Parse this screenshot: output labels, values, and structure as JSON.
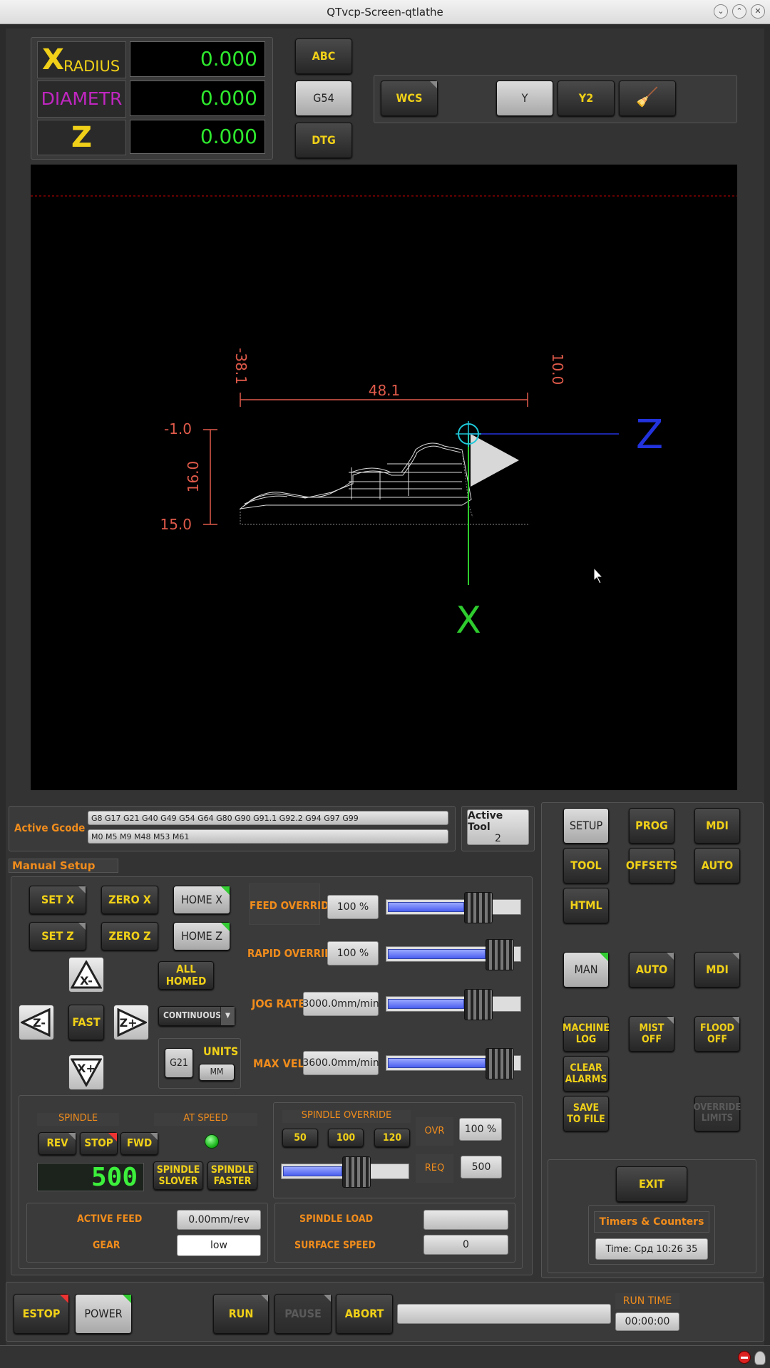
{
  "window": {
    "title": "QTvcp-Screen-qtlathe"
  },
  "dro": {
    "x": {
      "label_big": "X",
      "label_small": "RADIUS",
      "value": "0.000"
    },
    "d": {
      "label": "DIAMETR",
      "value": "0.000"
    },
    "z": {
      "label": "Z",
      "value": "0.000"
    }
  },
  "coord_buttons": {
    "abc": "ABC",
    "g54": "G54",
    "dtg": "DTG"
  },
  "view_buttons": {
    "wcs": "WCS",
    "y": "Y",
    "y2": "Y2"
  },
  "graphics": {
    "dim_z_left": "-38.1",
    "dim_z_right": "10.0",
    "dim_length": "48.1",
    "dim_x_top": "-1.0",
    "dim_x_len": "16.0",
    "dim_x_bottom": "15.0",
    "axis_z": "Z",
    "axis_x": "X"
  },
  "gcode": {
    "label": "Active Gcode",
    "g_codes": "G8 G17 G21 G40 G49 G54 G64 G80 G90 G91.1 G92.2 G94 G97 G99",
    "m_codes": "M0 M5 M9 M48 M53 M61"
  },
  "tool": {
    "label": "Active Tool",
    "value": "2"
  },
  "manual": {
    "title": "Manual Setup",
    "set_x": "SET X",
    "zero_x": "ZERO X",
    "home_x": "HOME X",
    "set_z": "SET Z",
    "zero_z": "ZERO Z",
    "home_z": "HOME Z",
    "all_homed": "ALL HOMED",
    "fast": "FAST",
    "continuous": "CONTINUOUS",
    "g21": "G21",
    "units": "UNITS",
    "mm": "MM",
    "jog_x_minus": "X-",
    "jog_x_plus": "X+",
    "jog_z_minus": "Z-",
    "jog_z_plus": "Z+"
  },
  "overrides": {
    "feed": {
      "label": "FEED OVERRIDE",
      "value": "100 %",
      "level": 0.78
    },
    "rapid": {
      "label": "RAPID OVERRIDE",
      "value": "100 %",
      "level": 1.0
    },
    "jog": {
      "label": "JOG RATE",
      "value": "3000.0mm/min",
      "level": 0.78
    },
    "maxvel": {
      "label": "MAX VEL",
      "value": "3600.0mm/min",
      "level": 1.0
    }
  },
  "spindle": {
    "label": "SPINDLE",
    "at_speed": "AT SPEED",
    "rev": "REV",
    "stop": "STOP",
    "fwd": "FWD",
    "rpm": "500",
    "slower": "SPINDLE\nSLOVER",
    "faster": "SPINDLE\nFASTER",
    "override_label": "SPINDLE OVERRIDE",
    "p50": "50",
    "p100": "100",
    "p120": "120",
    "ovr_label": "OVR",
    "ovr_value": "100 %",
    "req_label": "REQ",
    "req_value": "500",
    "override_level": 0.65
  },
  "status": {
    "active_feed_label": "ACTIVE FEED",
    "active_feed": "0.00mm/rev",
    "gear_label": "GEAR",
    "gear": "low",
    "load_label": "SPINDLE LOAD",
    "surface_label": "SURFACE SPEED",
    "surface": "0"
  },
  "nav": {
    "setup": "SETUP",
    "prog": "PROG",
    "mdi": "MDI",
    "tool": "TOOL",
    "offsets": "OFFSETS",
    "auto": "AUTO",
    "html": "HTML"
  },
  "mode": {
    "man": "MAN",
    "auto": "AUTO",
    "mdi": "MDI"
  },
  "actions": {
    "machine_log": "MACHINE\nLOG",
    "mist_off": "MIST\nOFF",
    "flood_off": "FLOOD\nOFF",
    "clear_alarms": "CLEAR\nALARMS",
    "save_to_file": "SAVE\nTO FILE",
    "override_limits": "OVERRIDE\nLIMITS"
  },
  "exit": "EXIT",
  "timers": {
    "title": "Timers & Counters",
    "time": "Time:   Срд 10:26 35"
  },
  "bottom": {
    "estop": "ESTOP",
    "power": "POWER",
    "run": "RUN",
    "pause": "PAUSE",
    "abort": "ABORT",
    "run_time_label": "RUN TIME",
    "run_time": "00:00:00"
  },
  "colors": {
    "accent": "#f0d018",
    "label": "#f08c1c",
    "dro": "#2ee82e",
    "diameter": "#c026c0"
  }
}
